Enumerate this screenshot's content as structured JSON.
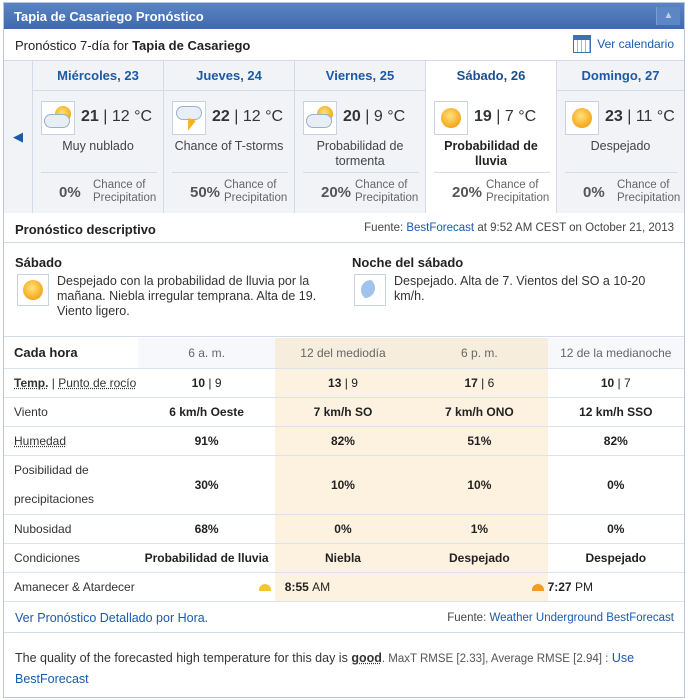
{
  "widget": {
    "title": "Tapia de Casariego Pronóstico",
    "collapse_glyph": "▲",
    "subheader_prefix": "Pronóstico 7-día for",
    "location": "Tapia de Casariego",
    "calendar_link": "Ver calendario"
  },
  "days": [
    {
      "name": "Miércoles, 23",
      "high": "21",
      "low": "12 °C",
      "condition": "Muy nublado",
      "pop": "0%",
      "pop_label": "Chance of Precipitation",
      "icon": "partly-cloudy-icon"
    },
    {
      "name": "Jueves, 24",
      "high": "22",
      "low": "12 °C",
      "condition": "Chance of T-storms",
      "pop": "50%",
      "pop_label": "Chance of Precipitation",
      "icon": "thunderstorm-icon"
    },
    {
      "name": "Viernes, 25",
      "high": "20",
      "low": "9 °C",
      "condition": "Probabilidad de tormenta",
      "pop": "20%",
      "pop_label": "Chance of Precipitation",
      "icon": "partly-cloudy-icon"
    },
    {
      "name": "Sábado, 26",
      "high": "19",
      "low": "7 °C",
      "condition": "Probabilidad de lluvia",
      "pop": "20%",
      "pop_label": "Chance of Precipitation",
      "icon": "sun-icon",
      "selected": true
    },
    {
      "name": "Domingo, 27",
      "high": "23",
      "low": "11 °C",
      "condition": "Despejado",
      "pop": "0%",
      "pop_label": "Chance of Precipitation",
      "icon": "sun-icon"
    }
  ],
  "description": {
    "title": "Pronóstico descriptivo",
    "source_prefix": "Fuente:",
    "source_link": "BestForecast",
    "source_suffix": "at 9:52 AM CEST on October 21, 2013",
    "day": {
      "heading": "Sábado",
      "text": "Despejado con la probabilidad de lluvia por la mañana. Niebla irregular temprana. Alta de 19. Viento ligero."
    },
    "night": {
      "heading": "Noche del sábado",
      "text": "Despejado. Alta de 7. Vientos del SO a 10-20 km/h."
    }
  },
  "hourly": {
    "header_label": "Cada hora",
    "columns": [
      "6 a. m.",
      "12 del mediodía",
      "6 p. m.",
      "12 de la medianoche"
    ],
    "temp_label": "Temp.",
    "dew_label": "Punto de rocío",
    "temps": [
      [
        "10",
        "9"
      ],
      [
        "13",
        "9"
      ],
      [
        "17",
        "6"
      ],
      [
        "10",
        "7"
      ]
    ],
    "rows": [
      {
        "label": "Viento",
        "values": [
          "6 km/h Oeste",
          "7 km/h SO",
          "7 km/h ONO",
          "12 km/h SSO"
        ]
      },
      {
        "label": "Humedad",
        "values": [
          "91%",
          "82%",
          "51%",
          "82%"
        ]
      },
      {
        "label": "Posibilidad de precipitaciones",
        "values": [
          "30%",
          "10%",
          "10%",
          "0%"
        ]
      },
      {
        "label": "Nubosidad",
        "values": [
          "68%",
          "0%",
          "1%",
          "0%"
        ]
      },
      {
        "label": "Condiciones",
        "values": [
          "Probabilidad de lluvia",
          "Niebla",
          "Despejado",
          "Despejado"
        ]
      }
    ],
    "sun_label": "Amanecer & Atardecer",
    "sunrise_time": "8:55",
    "sunrise_ampm": "AM",
    "sunset_time": "7:27",
    "sunset_ampm": "PM"
  },
  "footer": {
    "hourly_link": "Ver Pronóstico Detallado por Hora.",
    "source_prefix": "Fuente:",
    "source_link": "Weather Underground BestForecast"
  },
  "quality": {
    "prefix": "The quality of the forecasted high temperature for this day is",
    "rating": "good",
    "stats": ". MaxT RMSE [2.33], Average RMSE [2.94] :",
    "link": "Use BestForecast"
  },
  "colors": {
    "accent": "#1a5aa8",
    "title_bar": "#4a75b8",
    "highlight": "#fdf2e0",
    "sun": "#f6a71c"
  }
}
